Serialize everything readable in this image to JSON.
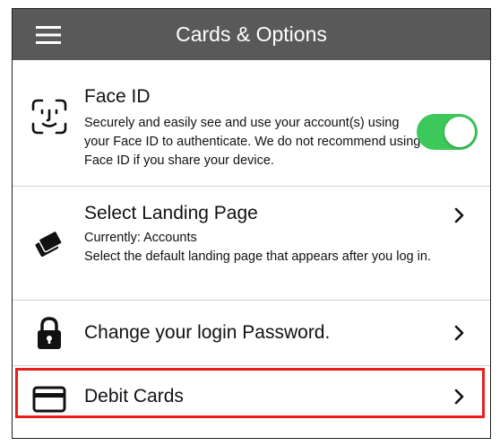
{
  "header": {
    "title": "Cards & Options",
    "menu_icon": "hamburger-menu-icon"
  },
  "face_id": {
    "icon": "face-id-icon",
    "title": "Face ID",
    "description": "Securely and easily see and use your account(s) using your Face ID to authenticate.  We do not recommend using Face ID if you share your device.",
    "toggle_on": true,
    "toggle_color": "#3cc85a"
  },
  "landing_page": {
    "icon": "cards-icon",
    "title": "Select Landing Page",
    "current": "Currently: Accounts",
    "description": "Select the default landing page that appears after you log in."
  },
  "password": {
    "icon": "lock-icon",
    "title": "Change your login Password."
  },
  "debit_cards": {
    "icon": "credit-card-icon",
    "title": "Debit Cards",
    "highlight_color": "#e8201c"
  }
}
